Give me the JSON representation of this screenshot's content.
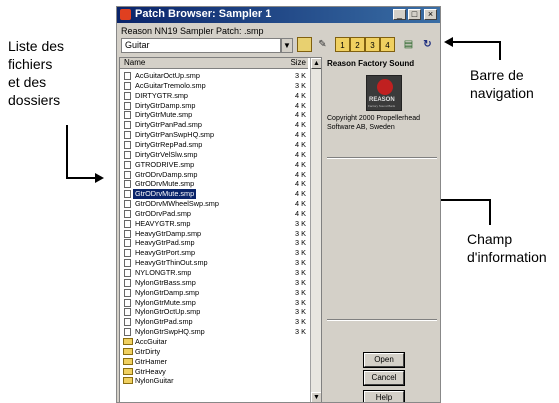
{
  "annotations": {
    "left": [
      "Liste des",
      "fichiers",
      "et des",
      "dossiers"
    ],
    "right_top": [
      "Barre de",
      "navigation"
    ],
    "right_bottom": [
      "Champ",
      "d'information"
    ]
  },
  "window": {
    "title": "Patch Browser: Sampler 1",
    "controls": [
      "_",
      "□",
      "×"
    ],
    "subtitle": "Reason NN19 Sampler Patch: .smp",
    "folder": "Guitar"
  },
  "list": {
    "columns": {
      "name": "Name",
      "size": "Size"
    },
    "selected_index": 12,
    "files": [
      {
        "name": "AcGuitarOctUp.smp",
        "size": "3 K"
      },
      {
        "name": "AcGuitarTremolo.smp",
        "size": "3 K"
      },
      {
        "name": "DIRTYGTR.smp",
        "size": "4 K"
      },
      {
        "name": "DirtyGtrDamp.smp",
        "size": "4 K"
      },
      {
        "name": "DirtyGtrMute.smp",
        "size": "4 K"
      },
      {
        "name": "DirtyGtrPanPad.smp",
        "size": "4 K"
      },
      {
        "name": "DirtyGtrPanSwpHQ.smp",
        "size": "4 K"
      },
      {
        "name": "DirtyGtrRepPad.smp",
        "size": "4 K"
      },
      {
        "name": "DirtyGtrVelSlw.smp",
        "size": "4 K"
      },
      {
        "name": "GTRODRIVE.smp",
        "size": "4 K"
      },
      {
        "name": "GtrODrvDamp.smp",
        "size": "4 K"
      },
      {
        "name": "GtrODrvMute.smp",
        "size": "4 K"
      },
      {
        "name": "GtrODrvMute.smp",
        "size": "4 K"
      },
      {
        "name": "GtrODrvMWheelSwp.smp",
        "size": "4 K"
      },
      {
        "name": "GtrODrvPad.smp",
        "size": "4 K"
      },
      {
        "name": "HEAVYGTR.smp",
        "size": "3 K"
      },
      {
        "name": "HeavyGtrDamp.smp",
        "size": "3 K"
      },
      {
        "name": "HeavyGtrPad.smp",
        "size": "3 K"
      },
      {
        "name": "HeavyGtrPort.smp",
        "size": "3 K"
      },
      {
        "name": "HeavyGtrThinOut.smp",
        "size": "3 K"
      },
      {
        "name": "NYLONGTR.smp",
        "size": "3 K"
      },
      {
        "name": "NylonGtrBass.smp",
        "size": "3 K"
      },
      {
        "name": "NylonGtrDamp.smp",
        "size": "3 K"
      },
      {
        "name": "NylonGtrMute.smp",
        "size": "3 K"
      },
      {
        "name": "NylonGtrOctUp.smp",
        "size": "3 K"
      },
      {
        "name": "NylonGtrPad.smp",
        "size": "3 K"
      },
      {
        "name": "NylonGtrSwpHQ.smp",
        "size": "3 K"
      }
    ],
    "folders": [
      "AccGuitar",
      "GtrDirty",
      "GtrHamer",
      "GtrHeavy",
      "NylonGuitar"
    ]
  },
  "info": {
    "title": "Reason Factory Sound",
    "logo_text": "REASON",
    "logo_sub": "Factory Sound Bank",
    "copyright": "Copyright 2000 Propellerhead Software AB, Sweden"
  },
  "buttons": {
    "open": "Open",
    "cancel": "Cancel",
    "help": "Help"
  },
  "nav_icons": [
    "folder-up-icon",
    "new-folder-icon",
    "disk-1-icon",
    "disk-2-icon",
    "disk-3-icon",
    "disk-4-icon",
    "browse-icon",
    "refresh-icon"
  ],
  "colors": {
    "selection": "#0a246a",
    "face": "#d4d0c8",
    "titlebar": "#0a246a"
  }
}
